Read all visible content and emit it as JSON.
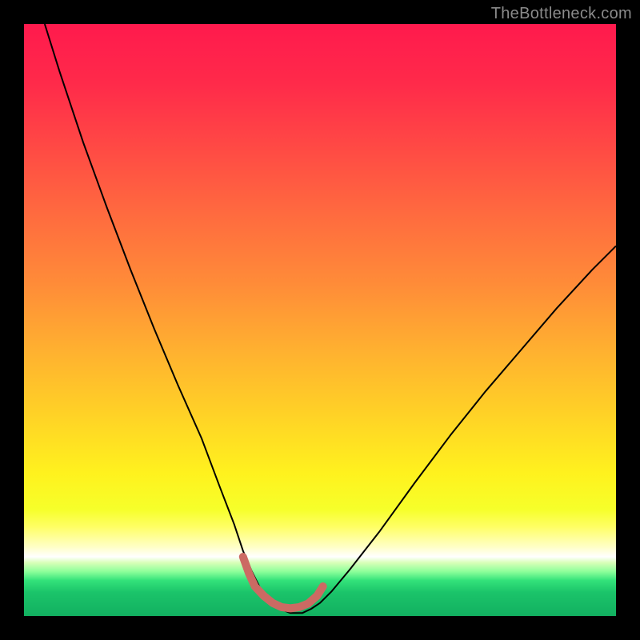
{
  "watermark": {
    "text": "TheBottleneck.com"
  },
  "chart_data": {
    "type": "line",
    "title": "",
    "xlabel": "",
    "ylabel": "",
    "xlim": [
      0,
      100
    ],
    "ylim": [
      0,
      100
    ],
    "grid": false,
    "legend": false,
    "background": {
      "type": "vertical-gradient",
      "note": "percent y from top → color; red=high bottleneck, green=optimal",
      "stops": [
        {
          "y": 0,
          "color": "#ff1a4d"
        },
        {
          "y": 10,
          "color": "#ff2a4a"
        },
        {
          "y": 20,
          "color": "#ff4745"
        },
        {
          "y": 32,
          "color": "#ff6a3f"
        },
        {
          "y": 44,
          "color": "#ff8c38"
        },
        {
          "y": 55,
          "color": "#ffb030"
        },
        {
          "y": 66,
          "color": "#ffd226"
        },
        {
          "y": 76,
          "color": "#fff21e"
        },
        {
          "y": 82,
          "color": "#f6ff2a"
        },
        {
          "y": 85,
          "color": "#ffff66"
        },
        {
          "y": 88.5,
          "color": "#ffffcc"
        },
        {
          "y": 90,
          "color": "#ffffff"
        },
        {
          "y": 91,
          "color": "#d8ffb8"
        },
        {
          "y": 92.5,
          "color": "#8cff9a"
        },
        {
          "y": 94,
          "color": "#33e27a"
        },
        {
          "y": 96,
          "color": "#1bc46a"
        },
        {
          "y": 100,
          "color": "#12b060"
        }
      ]
    },
    "series": [
      {
        "name": "bottleneck-curve",
        "stroke": "#000000",
        "stroke_width": 2,
        "x": [
          3.5,
          6,
          10,
          14,
          18,
          22,
          26,
          30,
          33,
          35.5,
          37,
          38.5,
          40,
          41.5,
          43,
          45,
          47,
          48.5,
          50,
          52,
          55,
          60,
          66,
          72,
          78,
          84,
          90,
          96,
          100
        ],
        "y": [
          100,
          92,
          80,
          69,
          58.5,
          48.5,
          39,
          30,
          22,
          15.5,
          11,
          7.5,
          4.5,
          2.5,
          1.3,
          0.5,
          0.5,
          1.2,
          2.2,
          4.2,
          7.8,
          14.2,
          22.5,
          30.5,
          38,
          45,
          52,
          58.5,
          62.5
        ]
      },
      {
        "name": "optimal-range-marker",
        "stroke": "#cc6a63",
        "stroke_width": 10,
        "stroke_linecap": "round",
        "note": "thick pink segment hugging the valley floor",
        "x": [
          37.0,
          38.0,
          39.0,
          40.5,
          42.0,
          43.5,
          45.0,
          46.5,
          48.0,
          49.5,
          50.5
        ],
        "y": [
          10.0,
          7.2,
          5.0,
          3.4,
          2.2,
          1.5,
          1.3,
          1.5,
          2.1,
          3.4,
          5.0
        ]
      }
    ]
  }
}
